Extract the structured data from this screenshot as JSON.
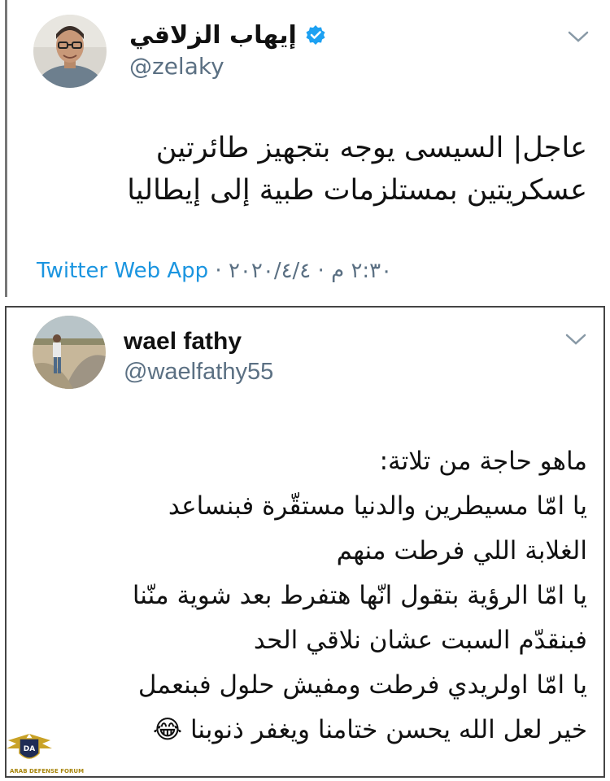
{
  "tweet1": {
    "display_name": "إيهاب الزلاقي",
    "handle": "@zelaky",
    "verified": true,
    "text_lines": [
      "عاجل| السيسى يوجه بتجهيز طائرتين",
      "عسكريتين بمستلزمات طبية إلى إيطاليا"
    ],
    "time": "٢:٣٠ م",
    "date": "٢٠٢٠/٤/٤",
    "separator": "·",
    "source": "Twitter Web App"
  },
  "tweet2": {
    "display_name": "wael fathy",
    "handle": "@waelfathy55",
    "text_lines": [
      "ماهو حاجة من تلاتة:",
      "يا امّا مسيطرين والدنيا مستقّرة فبنساعد",
      "الغلابة اللي فرطت منهم",
      "يا امّا الرؤية بتقول انّها هتفرط بعد شوية منّنا",
      "فبنقدّم السبت عشان نلاقي الحد",
      "يا امّا اولريدي فرطت ومفيش حلول فبنعمل",
      "خير لعل الله يحسن ختامنا ويغفر ذنوبنا 😂"
    ]
  },
  "watermark": {
    "logo_text": "ARAB DEFENSE FORUM",
    "logo_initials": "DA"
  },
  "colors": {
    "handle_gray": "#5b7083",
    "link_blue": "#1b95e0",
    "verified_blue": "#1da1f2"
  }
}
